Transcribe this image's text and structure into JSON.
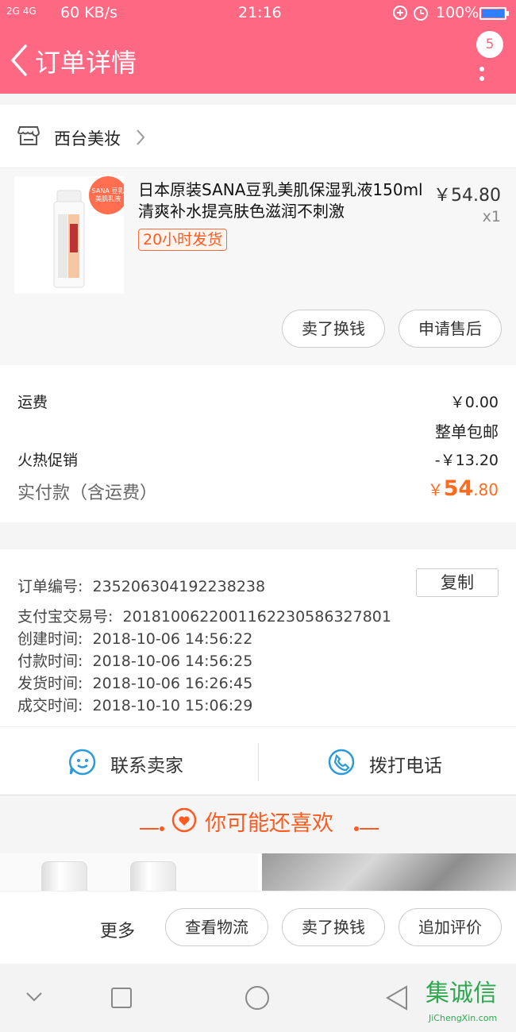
{
  "status_bar": {
    "signal": "2G 4G",
    "speed": "60 KB/s",
    "time": "21:16",
    "battery": "100%"
  },
  "header": {
    "title": "订单详情",
    "badge": "5"
  },
  "shop": {
    "name": "西台美妆"
  },
  "product": {
    "title": "日本原装SANA豆乳美肌保湿乳液150ml 清爽补水提亮肤色滋润不刺激",
    "tag": "20小时发货",
    "price": "￥54.80",
    "quantity": "x1",
    "actions": [
      "卖了换钱",
      "申请售后"
    ],
    "image_label": "SANA 豆乳美肌乳液"
  },
  "fees": {
    "shipping_label": "运费",
    "shipping_value": "￥0.00",
    "shipping_note": "整单包邮",
    "promo_label": "火热促销",
    "promo_value": "-￥13.20",
    "total_label": "实付款（含运费）",
    "total_currency": "￥",
    "total_int": "54",
    "total_dec": ".80"
  },
  "order_info": {
    "copy_label": "复制",
    "lines": [
      {
        "label": "订单编号:",
        "value": "235206304192238238"
      },
      {
        "label": "支付宝交易号:",
        "value": "2018100622001162230586327801"
      },
      {
        "label": "创建时间:",
        "value": "2018-10-06 14:56:22"
      },
      {
        "label": "付款时间:",
        "value": "2018-10-06 14:56:25"
      },
      {
        "label": "发货时间:",
        "value": "2018-10-06 16:26:45"
      },
      {
        "label": "成交时间:",
        "value": "2018-10-10 15:06:29"
      }
    ]
  },
  "contact": {
    "seller": "联系卖家",
    "phone": "拨打电话"
  },
  "recommend": {
    "title": "你可能还喜欢"
  },
  "bottom_actions": {
    "more": "更多",
    "buttons": [
      "查看物流",
      "卖了换钱",
      "追加评价"
    ]
  },
  "watermark": {
    "text": "集诚信",
    "url": "JiChengXin.com"
  },
  "colors": {
    "brand": "#fe6883",
    "accent": "#ff5a1f",
    "contact_icon": "#2a9bd8"
  }
}
